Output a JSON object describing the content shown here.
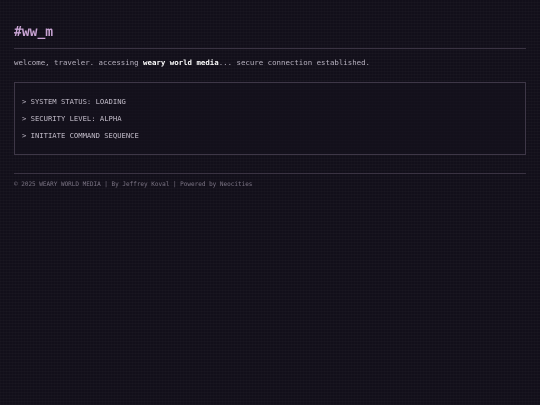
{
  "header": {
    "logo": "#ww_m"
  },
  "welcome": {
    "prefix": "welcome, traveler. accessing ",
    "brand": "weary world media",
    "suffix": "... secure connection established."
  },
  "terminal": {
    "lines": [
      "> SYSTEM STATUS: LOADING",
      "> SECURITY LEVEL: ALPHA",
      "> INITIATE COMMAND SEQUENCE"
    ]
  },
  "footer": {
    "text": "© 2025 WEARY WORLD MEDIA | By Jeffrey Koval | Powered by Neocities"
  }
}
